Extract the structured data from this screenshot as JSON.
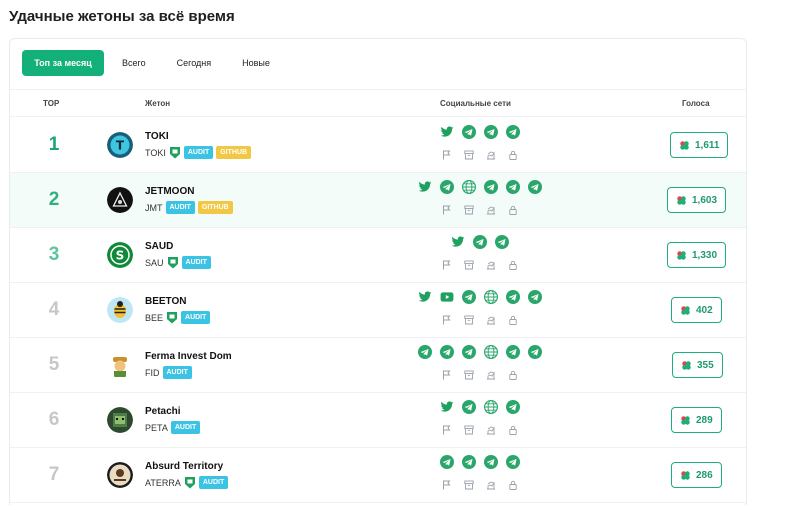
{
  "page": {
    "title": "Удачные жетоны за всё время"
  },
  "tabs": [
    {
      "label": "Топ за месяц",
      "active": true
    },
    {
      "label": "Всего",
      "active": false
    },
    {
      "label": "Сегодня",
      "active": false
    },
    {
      "label": "Новые",
      "active": false
    }
  ],
  "columns": {
    "top": "TOP",
    "token": "Жетон",
    "socials": "Социальные сети",
    "votes": "Голоса"
  },
  "badges": {
    "audit": "AUDIT",
    "github": "GITHUB"
  },
  "colors": {
    "accent": "#14b07a",
    "audit": "#3bc3e3",
    "github": "#f2c744",
    "twitter": "#1ea15f",
    "telegram": "#2aa66b",
    "rank_top": "#1aa770"
  },
  "tokens": [
    {
      "rank": "1",
      "name": "TOKI",
      "symbol": "TOKI",
      "shield": true,
      "audit": true,
      "github": true,
      "votes": "1,611",
      "socials": [
        "twitter-icon",
        "telegram-icon",
        "telegram-icon",
        "telegram-icon"
      ],
      "logo": "toki-logo"
    },
    {
      "rank": "2",
      "name": "JETMOON",
      "symbol": "JMT",
      "shield": false,
      "audit": true,
      "github": true,
      "votes": "1,603",
      "socials": [
        "twitter-icon",
        "telegram-icon",
        "globe-icon",
        "telegram-icon",
        "telegram-icon",
        "telegram-icon"
      ],
      "logo": "jetmoon-logo"
    },
    {
      "rank": "3",
      "name": "SAUD",
      "symbol": "SAU",
      "shield": true,
      "audit": true,
      "github": false,
      "votes": "1,330",
      "socials": [
        "twitter-icon",
        "telegram-icon",
        "telegram-icon"
      ],
      "logo": "saud-logo"
    },
    {
      "rank": "4",
      "name": "BEETON",
      "symbol": "BEE",
      "shield": true,
      "audit": true,
      "github": false,
      "votes": "402",
      "socials": [
        "twitter-icon",
        "youtube-icon",
        "telegram-icon",
        "globe-icon",
        "telegram-icon",
        "telegram-icon"
      ],
      "logo": "beeton-logo"
    },
    {
      "rank": "5",
      "name": "Ferma Invest Dom",
      "symbol": "FID",
      "shield": false,
      "audit": true,
      "github": false,
      "votes": "355",
      "socials": [
        "telegram-icon",
        "telegram-icon",
        "telegram-icon",
        "globe-icon",
        "telegram-icon",
        "telegram-icon"
      ],
      "logo": "ferma-logo"
    },
    {
      "rank": "6",
      "name": "Petachi",
      "symbol": "PETA",
      "shield": false,
      "audit": true,
      "github": false,
      "votes": "289",
      "socials": [
        "twitter-icon",
        "telegram-icon",
        "globe-icon",
        "telegram-icon"
      ],
      "logo": "petachi-logo"
    },
    {
      "rank": "7",
      "name": "Absurd Territory",
      "symbol": "ATERRA",
      "shield": true,
      "audit": true,
      "github": false,
      "votes": "286",
      "socials": [
        "telegram-icon",
        "telegram-icon",
        "telegram-icon",
        "telegram-icon"
      ],
      "logo": "absurd-logo"
    }
  ]
}
